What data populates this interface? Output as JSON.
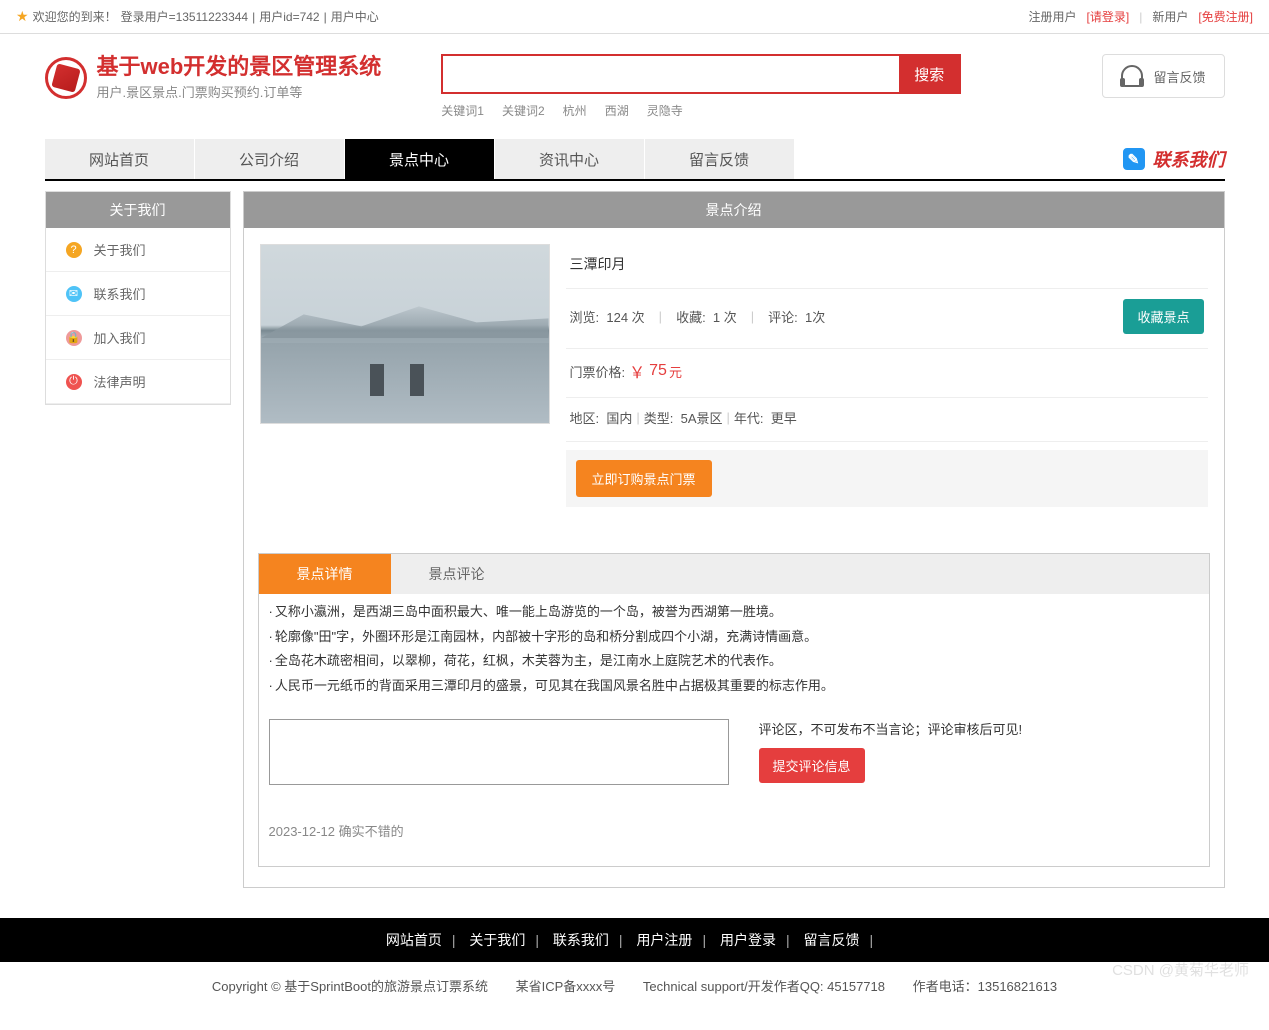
{
  "topbar": {
    "welcome": "欢迎您的到来！",
    "login_user": "登录用户=13511223344",
    "user_id": "用户id=742",
    "user_center": "用户中心",
    "reg_user_label": "注册用户",
    "please_login": "[请登录]",
    "new_user_label": "新用户",
    "free_register": "[免费注册]"
  },
  "logo": {
    "title": "基于web开发的景区管理系统",
    "subtitle": "用户.景区景点.门票购买预约.订单等"
  },
  "search": {
    "button": "搜索",
    "keywords": [
      "关键词1",
      "关键词2",
      "杭州",
      "西湖",
      "灵隐寺"
    ]
  },
  "feedback_label": "留言反馈",
  "nav": {
    "items": [
      "网站首页",
      "公司介绍",
      "景点中心",
      "资讯中心",
      "留言反馈"
    ],
    "contact": "联系我们"
  },
  "sidebar": {
    "title": "关于我们",
    "items": [
      {
        "icon": "?",
        "cls": "si-orange",
        "label": "关于我们"
      },
      {
        "icon": "✉",
        "cls": "si-blue",
        "label": "联系我们"
      },
      {
        "icon": "🔒",
        "cls": "si-peach",
        "label": "加入我们"
      },
      {
        "icon": "⏻",
        "cls": "si-red",
        "label": "法律声明"
      }
    ]
  },
  "content": {
    "header": "景点介绍",
    "spot_name": "三潭印月",
    "stats": {
      "view_label": "浏览:",
      "view_value": "124 次",
      "fav_label": "收藏:",
      "fav_value": "1 次",
      "comment_label": "评论:",
      "comment_value": "1次"
    },
    "collect_btn": "收藏景点",
    "price_label": "门票价格:",
    "price_symbol": "￥",
    "price_value": "75",
    "price_unit": "元",
    "meta": {
      "region_label": "地区:",
      "region": "国内",
      "type_label": "类型:",
      "type": "5A景区",
      "era_label": "年代:",
      "era": "更早"
    },
    "order_btn": "立即订购景点门票",
    "tabs": [
      "景点详情",
      "景点评论"
    ],
    "description": [
      "又称小瀛洲，是西湖三岛中面积最大、唯一能上岛游览的一个岛，被誉为西湖第一胜境。",
      "轮廓像\"田\"字，外圈环形是江南园林，内部被十字形的岛和桥分割成四个小湖，充满诗情画意。",
      "全岛花木疏密相间，以翠柳，荷花，红枫，木芙蓉为主，是江南水上庭院艺术的代表作。",
      "人民币一元纸币的背面采用三潭印月的盛景，可见其在我国风景名胜中占据极其重要的标志作用。"
    ],
    "comment_note": "评论区，不可发布不当言论；评论审核后可见!",
    "submit_btn": "提交评论信息",
    "comments": [
      {
        "text": "2023-12-12 确实不错的"
      }
    ]
  },
  "footer": {
    "nav": [
      "网站首页",
      "关于我们",
      "联系我们",
      "用户注册",
      "用户登录",
      "留言反馈"
    ],
    "copyright": "Copyright © 基于SprintBoot的旅游景点订票系统",
    "icp": "某省ICP备xxxx号",
    "support": "Technical support/开发作者QQ: 45157718",
    "phone": "作者电话：13516821613"
  },
  "watermark": "CSDN @黄菊华老师"
}
